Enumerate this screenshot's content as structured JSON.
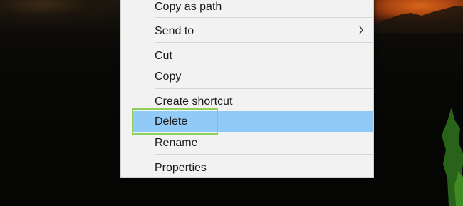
{
  "context_menu": {
    "items": [
      {
        "label": "Copy as path"
      },
      {
        "label": "Send to",
        "submenu_icon": "chevron-right-icon"
      },
      {
        "label": "Cut"
      },
      {
        "label": "Copy"
      },
      {
        "label": "Create shortcut"
      },
      {
        "label": "Delete",
        "state": "highlighted"
      },
      {
        "label": "Rename"
      },
      {
        "label": "Properties"
      }
    ]
  },
  "colors": {
    "menu_background": "#f2f2f2",
    "highlight": "#91c9f7",
    "annotation_box": "#8ed15a"
  }
}
